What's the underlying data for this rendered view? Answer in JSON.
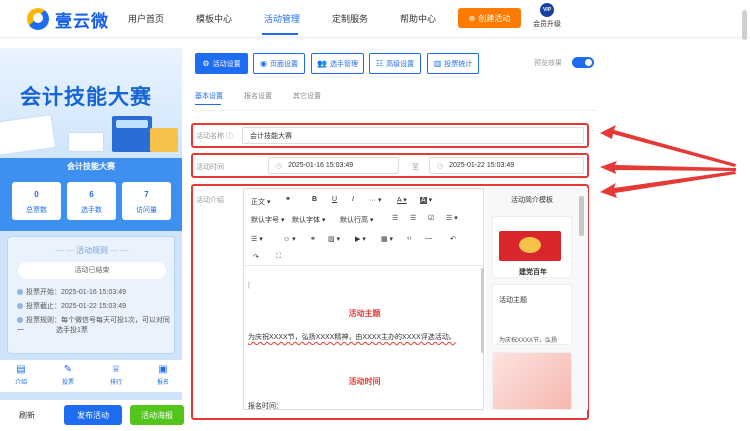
{
  "nav": {
    "logo_text": "壹云微",
    "items": [
      {
        "label": "用户首页",
        "active": false
      },
      {
        "label": "模板中心",
        "active": false
      },
      {
        "label": "活动管理",
        "active": true
      },
      {
        "label": "定制服务",
        "active": false
      },
      {
        "label": "帮助中心",
        "active": false
      }
    ],
    "create_button": "创建活动",
    "vip_badge": "VIP",
    "vip_label": "会员升级",
    "accent_color": "#1e6cf0",
    "create_color": "#ff7a00"
  },
  "preview": {
    "banner_title": "会计技能大赛",
    "activity_name": "会计技能大赛",
    "stats": [
      {
        "value": "0",
        "label": "总票数"
      },
      {
        "value": "6",
        "label": "选手数"
      },
      {
        "value": "7",
        "label": "访问量"
      }
    ],
    "rules_title": "活动规则",
    "rules_status": "活动已结束",
    "rules": [
      {
        "text": "投票开始：2025-01-16 15:03:49"
      },
      {
        "text": "投票截止：2025-01-22 15:03:49"
      },
      {
        "text": "投票规则：每个微信号每天可投1次，可以对同一"
      },
      {
        "text": "选手投1票"
      }
    ],
    "tabbar": [
      {
        "label": "介绍",
        "icon": "document-icon"
      },
      {
        "label": "投票",
        "icon": "vote-icon"
      },
      {
        "label": "排行",
        "icon": "trophy-icon"
      },
      {
        "label": "报名",
        "icon": "signup-icon"
      }
    ],
    "buttons": {
      "refresh": "刷新",
      "publish": "发布活动",
      "poster": "活动海报"
    }
  },
  "settings": {
    "toolbar": [
      {
        "label": "活动设置",
        "icon": "gear-icon",
        "active": true
      },
      {
        "label": "页面设置",
        "icon": "palette-icon",
        "active": false
      },
      {
        "label": "选手管理",
        "icon": "users-icon",
        "active": false
      },
      {
        "label": "高级设置",
        "icon": "sliders-icon",
        "active": false
      },
      {
        "label": "投票统计",
        "icon": "chart-icon",
        "active": false
      }
    ],
    "preview_toggle_label": "预览效果",
    "preview_toggle_on": true,
    "subtabs": [
      {
        "label": "基本设置",
        "active": true
      },
      {
        "label": "报名设置",
        "active": false
      },
      {
        "label": "其它设置",
        "active": false
      }
    ],
    "name_label": "活动名称",
    "name_value": "会计技能大赛",
    "time_label": "活动时间",
    "start_time": "2025-01-16 15:03:49",
    "time_separator": "至",
    "end_time": "2025-01-22 15:03:49",
    "intro_label": "活动介绍"
  },
  "editor": {
    "toolbar_row1": [
      "正文",
      "❝",
      "B",
      "U",
      "I",
      "···",
      "A",
      "A",
      "☰",
      "☰",
      "☑",
      "☰"
    ],
    "toolbar_row2": [
      "默认字号",
      "默认字体",
      "默认行高"
    ],
    "content": {
      "heading1": "活动主题",
      "paragraph": "为庆祝XXXX节，弘扬XXXX精神，由XXXX主办的XXXX评选活动。",
      "heading2": "活动时间",
      "line": "报名时间："
    }
  },
  "templates": {
    "title": "活动简介模板",
    "items": [
      {
        "text": "建党百年"
      },
      {
        "text": "活动主题"
      },
      {
        "text": "为庆祝XXXX节，弘扬"
      }
    ]
  }
}
